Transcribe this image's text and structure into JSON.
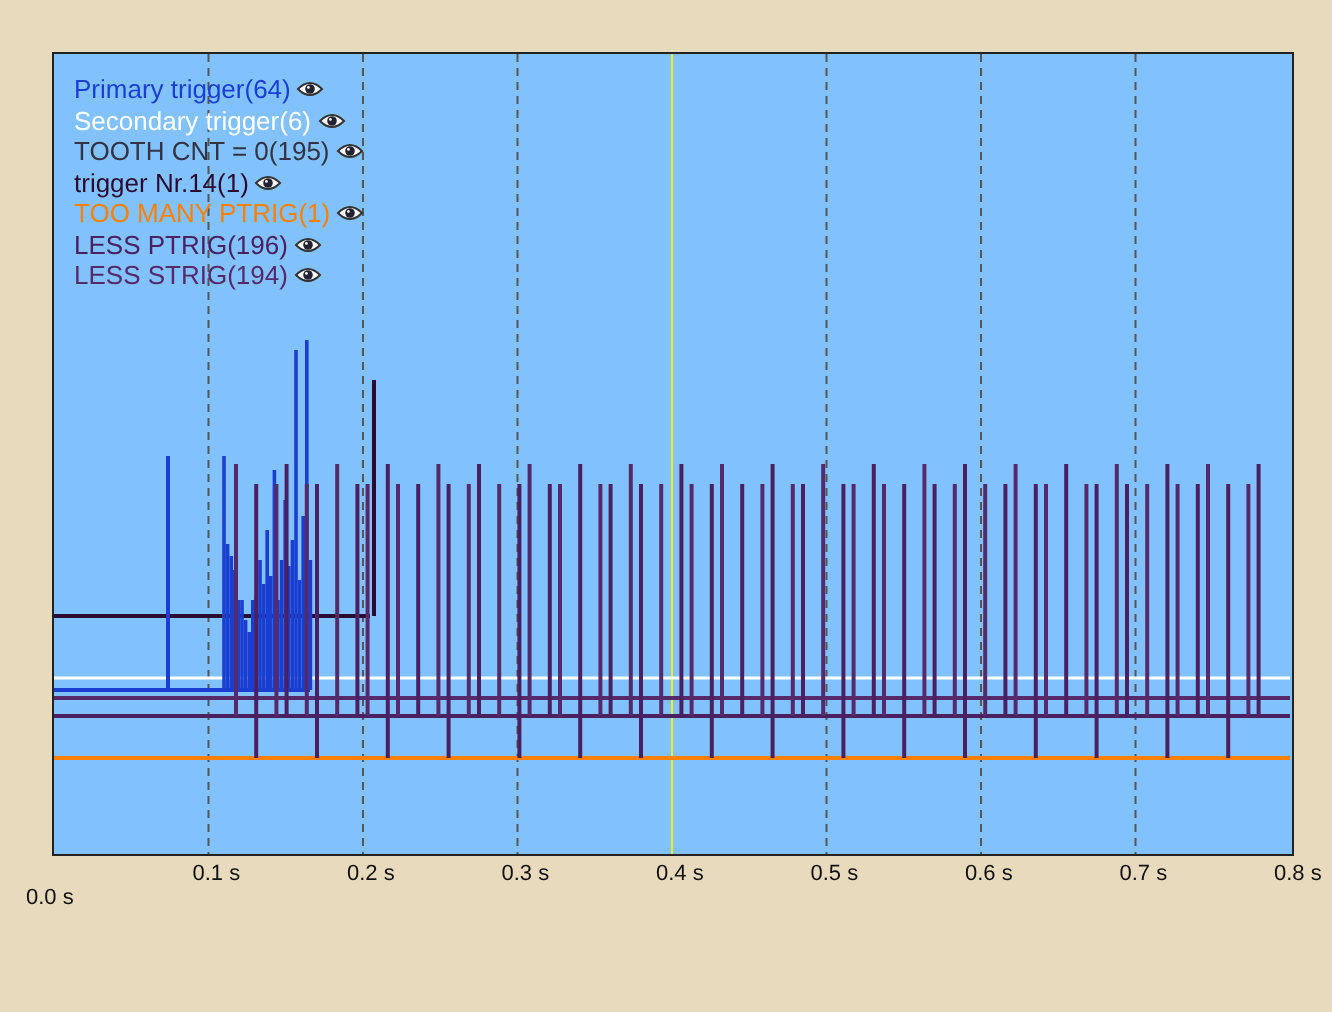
{
  "legend": [
    {
      "label": "Primary trigger(64)",
      "color": "#1a3fd0"
    },
    {
      "label": "Secondary trigger(6)",
      "color": "#ffffff"
    },
    {
      "label": "TOOTH CNT = 0(195)",
      "color": "#333344"
    },
    {
      "label": "trigger Nr.14(1)",
      "color": "#2a0a30"
    },
    {
      "label": "TOO MANY PTRIG(1)",
      "color": "#ff8000"
    },
    {
      "label": "LESS PTRIG(196)",
      "color": "#4a2060"
    },
    {
      "label": "LESS STRIG(194)",
      "color": "#562a6a"
    }
  ],
  "x_axis": {
    "origin_label": "0.0 s",
    "ticks": [
      {
        "label": "0.1 s",
        "kind": "grid"
      },
      {
        "label": "0.2 s",
        "kind": "grid"
      },
      {
        "label": "0.3 s",
        "kind": "grid"
      },
      {
        "label": "0.4 s",
        "kind": "cursor"
      },
      {
        "label": "0.5 s",
        "kind": "grid"
      },
      {
        "label": "0.6 s",
        "kind": "grid"
      },
      {
        "label": "0.7 s",
        "kind": "grid"
      },
      {
        "label": "0.8 s",
        "kind": "edge"
      }
    ]
  }
}
